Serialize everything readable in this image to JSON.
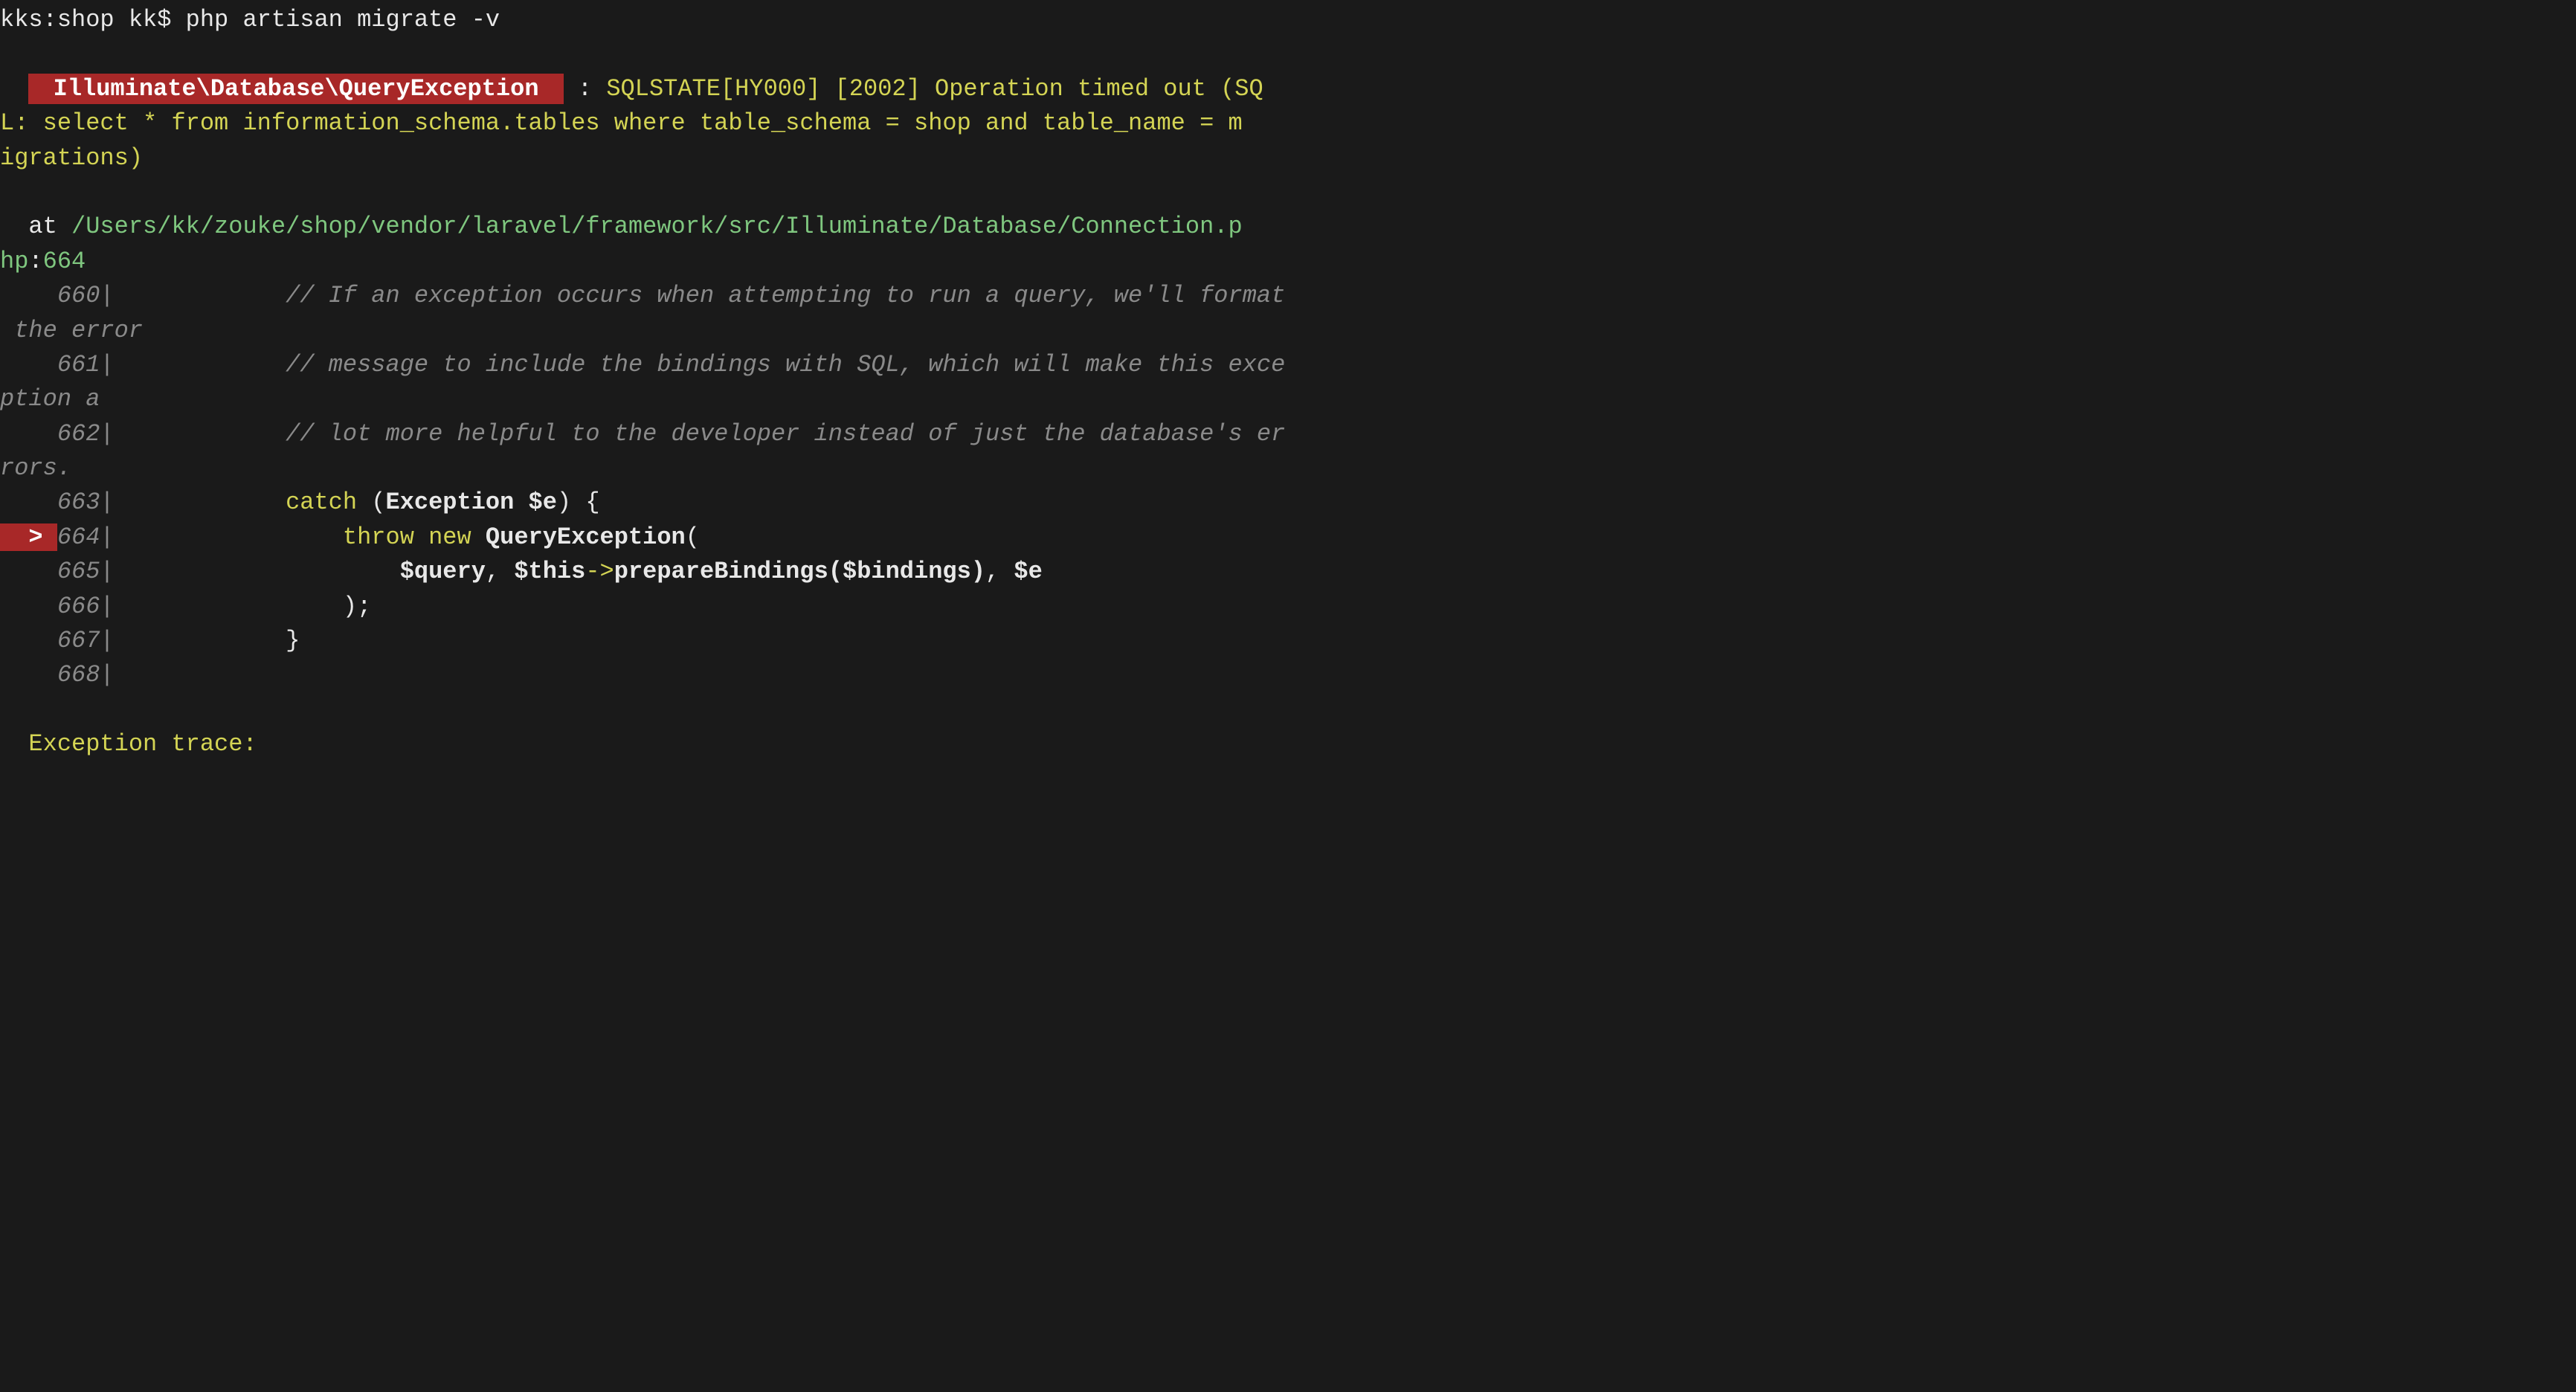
{
  "prompt": {
    "host": "kks:shop kk$",
    "command": "php artisan migrate -v"
  },
  "exception": {
    "class": " Illuminate\\Database\\QueryException ",
    "separator": " : ",
    "message_line1_a": "SQLSTATE[HY000] [2002] Operation timed out (SQ",
    "message_line2": "L: select * from information_schema.tables where table_schema = shop and table_name = m",
    "message_line3": "igrations)"
  },
  "location": {
    "at_label": "  at ",
    "path": "/Users/kk/zouke/shop/vendor/laravel/framework/src/Illuminate/Database/Connection.p",
    "path_wrap": "hp",
    "colon": ":",
    "line_no": "664"
  },
  "source": {
    "l660": {
      "gutter": "    660| ",
      "indent": "           ",
      "comment": "// If an exception occurs when attempting to run a query, we'll format",
      "wrap": " the error"
    },
    "l661": {
      "gutter": "    661| ",
      "indent": "           ",
      "comment": "// message to include the bindings with SQL, which will make this exce",
      "wrap": "ption a"
    },
    "l662": {
      "gutter": "    662| ",
      "indent": "           ",
      "comment": "// lot more helpful to the developer instead of just the database's er",
      "wrap": "rors."
    },
    "l663": {
      "gutter": "    663| ",
      "indent": "           ",
      "kw_catch": "catch ",
      "paren_open": "(",
      "exc": "Exception $e",
      "paren_close": ") {"
    },
    "l664": {
      "arrow": "  > ",
      "gutter": "664| ",
      "indent": "               ",
      "kw_throw": "throw ",
      "kw_new": "new ",
      "exc": "QueryException",
      "paren": "("
    },
    "l665": {
      "gutter": "    665| ",
      "indent": "                   ",
      "var_query": "$query",
      "comma1": ", ",
      "var_this": "$this",
      "arrow_op": "->",
      "method": "prepareBindings",
      "paren_open": "(",
      "var_bindings": "$bindings",
      "paren_close": ")",
      "comma2": ", ",
      "var_e": "$e"
    },
    "l666": {
      "gutter": "    666| ",
      "indent": "               ",
      "code": ");"
    },
    "l667": {
      "gutter": "    667| ",
      "indent": "           ",
      "code": "}"
    },
    "l668": {
      "gutter": "    668| "
    }
  },
  "trace": {
    "header": "  Exception trace:"
  }
}
